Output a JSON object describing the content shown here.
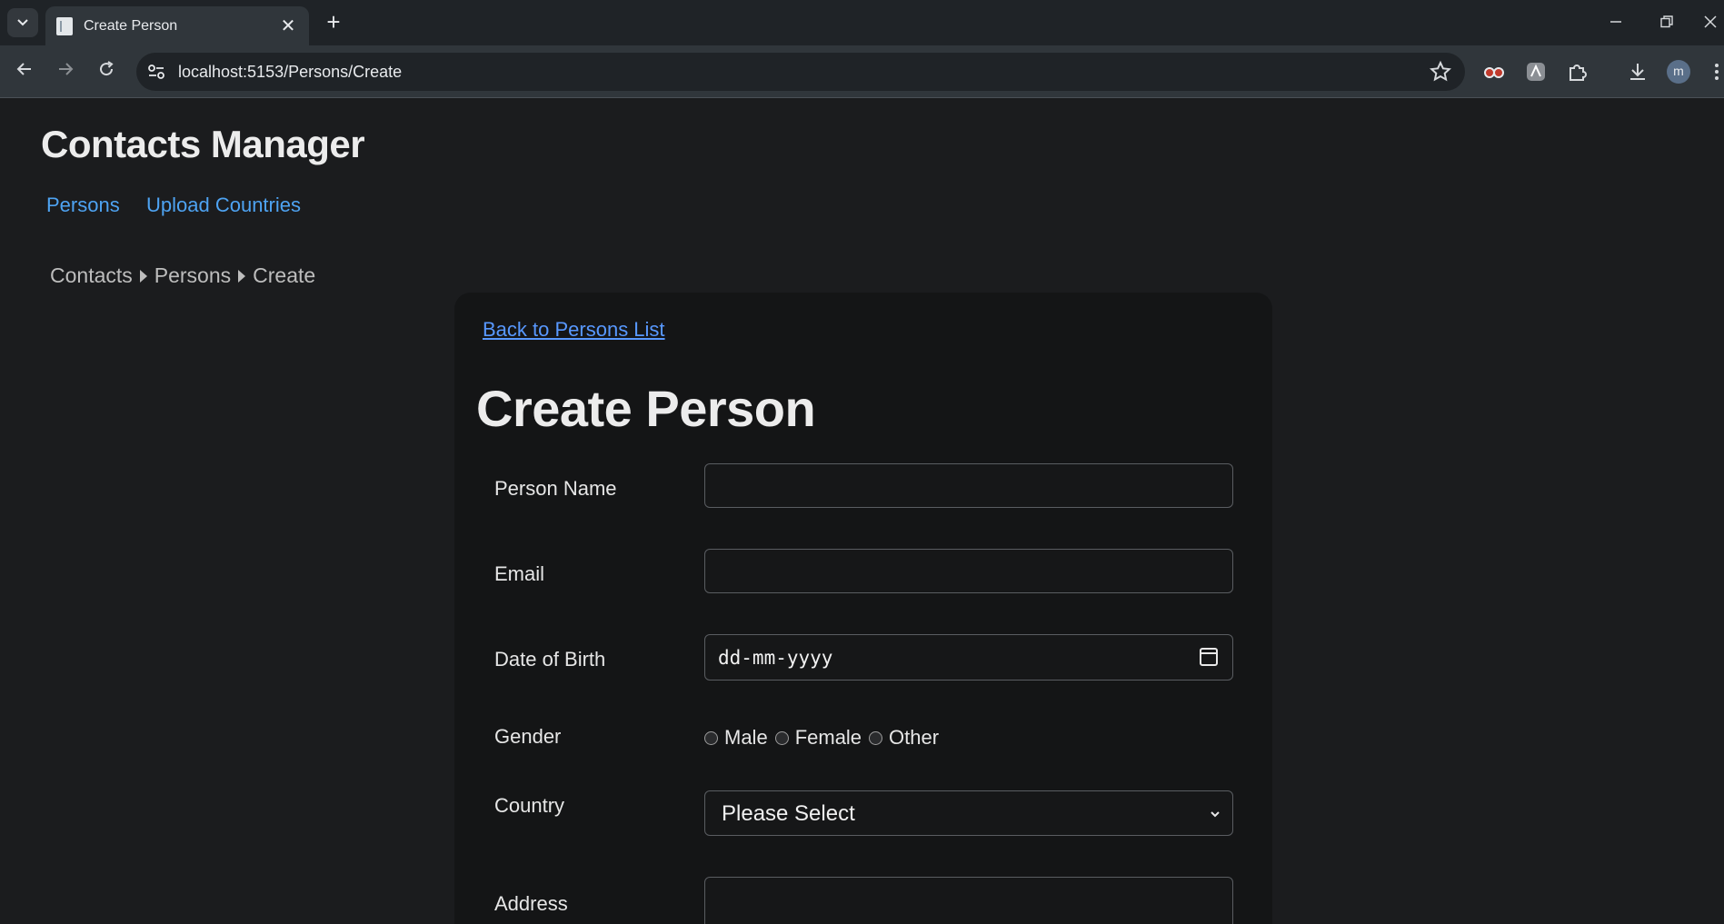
{
  "browser": {
    "tab_title": "Create Person",
    "tab_close": "✕",
    "new_tab": "+",
    "url": "localhost:5153/Persons/Create",
    "profile_initial": "m"
  },
  "app": {
    "title": "Contacts Manager",
    "nav": [
      "Persons",
      "Upload Countries"
    ]
  },
  "breadcrumb": [
    "Contacts",
    "Persons",
    "Create"
  ],
  "page": {
    "back_link": "Back to Persons List",
    "title": "Create Person"
  },
  "form": {
    "person_name": {
      "label": "Person Name",
      "value": ""
    },
    "email": {
      "label": "Email",
      "value": ""
    },
    "date_of_birth": {
      "label": "Date of Birth",
      "placeholder": "dd-mm-yyyy"
    },
    "gender": {
      "label": "Gender",
      "options": [
        "Male",
        "Female",
        "Other"
      ],
      "selected": null
    },
    "country": {
      "label": "Country",
      "selected": "Please Select"
    },
    "address": {
      "label": "Address",
      "value": ""
    }
  },
  "colors": {
    "page_bg": "#1b1c1e",
    "card_bg": "#141516",
    "link": "#4ea3f2",
    "back_link": "#5898ff"
  }
}
